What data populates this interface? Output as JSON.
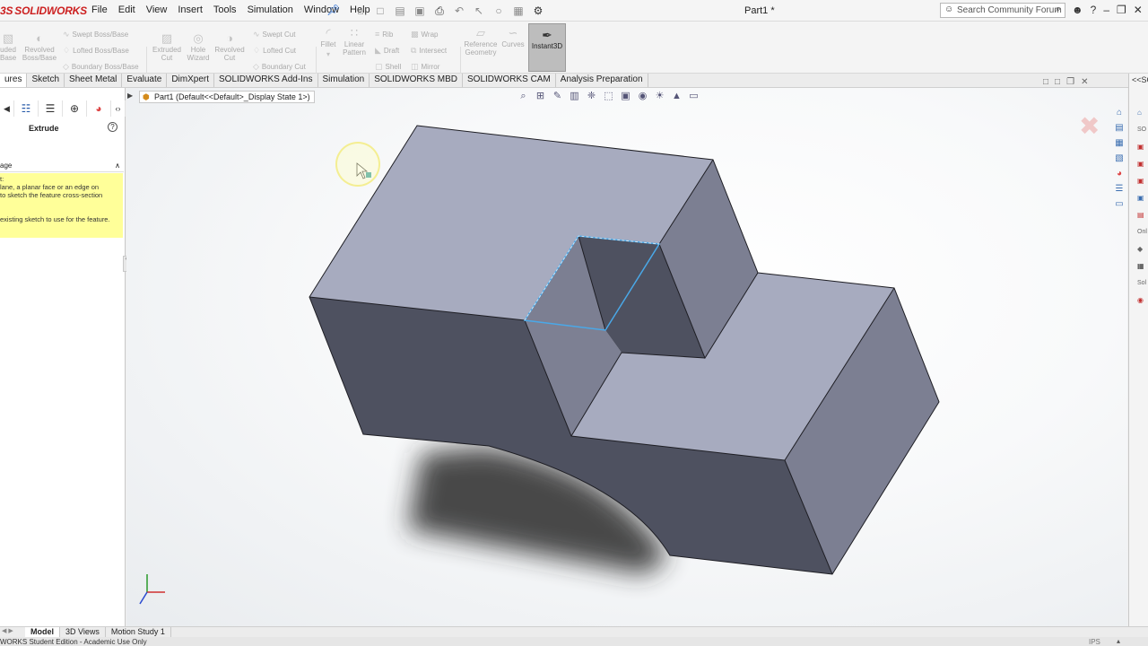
{
  "app": {
    "logo_ds": "3S",
    "logo_text": "SOLIDWORKS",
    "doc_title": "Part1 *",
    "menu": [
      "File",
      "Edit",
      "View",
      "Insert",
      "Tools",
      "Simulation",
      "Window",
      "Help"
    ],
    "search_placeholder": "Search Community Forum"
  },
  "command_manager": {
    "left_cut": "uded\nBase",
    "revolved_boss": "Revolved\nBoss/Base",
    "swept_boss": "Swept Boss/Base",
    "lofted_boss": "Lofted Boss/Base",
    "boundary_boss": "Boundary Boss/Base",
    "extruded_cut": "Extruded\nCut",
    "hole_wizard": "Hole\nWizard",
    "revolved_cut": "Revolved\nCut",
    "swept_cut": "Swept Cut",
    "lofted_cut": "Lofted Cut",
    "boundary_cut": "Boundary Cut",
    "fillet": "Fillet",
    "linear_pattern": "Linear\nPattern",
    "rib": "Rib",
    "draft": "Draft",
    "shell": "Shell",
    "wrap": "Wrap",
    "intersect": "Intersect",
    "mirror": "Mirror",
    "reference_geometry": "Reference\nGeometry",
    "curves": "Curves",
    "instant3d": "Instant3D"
  },
  "tabs": [
    "ures",
    "Sketch",
    "Sheet Metal",
    "Evaluate",
    "DimXpert",
    "SOLIDWORKS Add-Ins",
    "Simulation",
    "SOLIDWORKS MBD",
    "SOLIDWORKS CAM",
    "Analysis Preparation"
  ],
  "active_tab_index": 0,
  "property_manager": {
    "title": "Extrude",
    "help": "?",
    "section": "age",
    "message_lines": [
      "t:",
      "lane, a planar face or an edge on",
      "to sketch the feature cross-section",
      "",
      "",
      "existing sketch to use for the feature."
    ]
  },
  "viewport": {
    "breadcrumb": "Part1  (Default<<Default>_Display State 1>)"
  },
  "right_panel": {
    "header": "<<SO",
    "labels": [
      "SO",
      "Onl",
      "Sol"
    ]
  },
  "bottom_tabs": [
    "Model",
    "3D Views",
    "Motion Study 1"
  ],
  "active_bottom_tab": 0,
  "status": {
    "left": "WORKS Student Edition - Academic Use Only",
    "units": "IPS"
  },
  "colors": {
    "top_face": "#a7abbf",
    "right_side": "#7c7f92",
    "front_face": "#4e5160",
    "selection_edge": "#4aa8e8",
    "brand": "#cc1f1f"
  }
}
